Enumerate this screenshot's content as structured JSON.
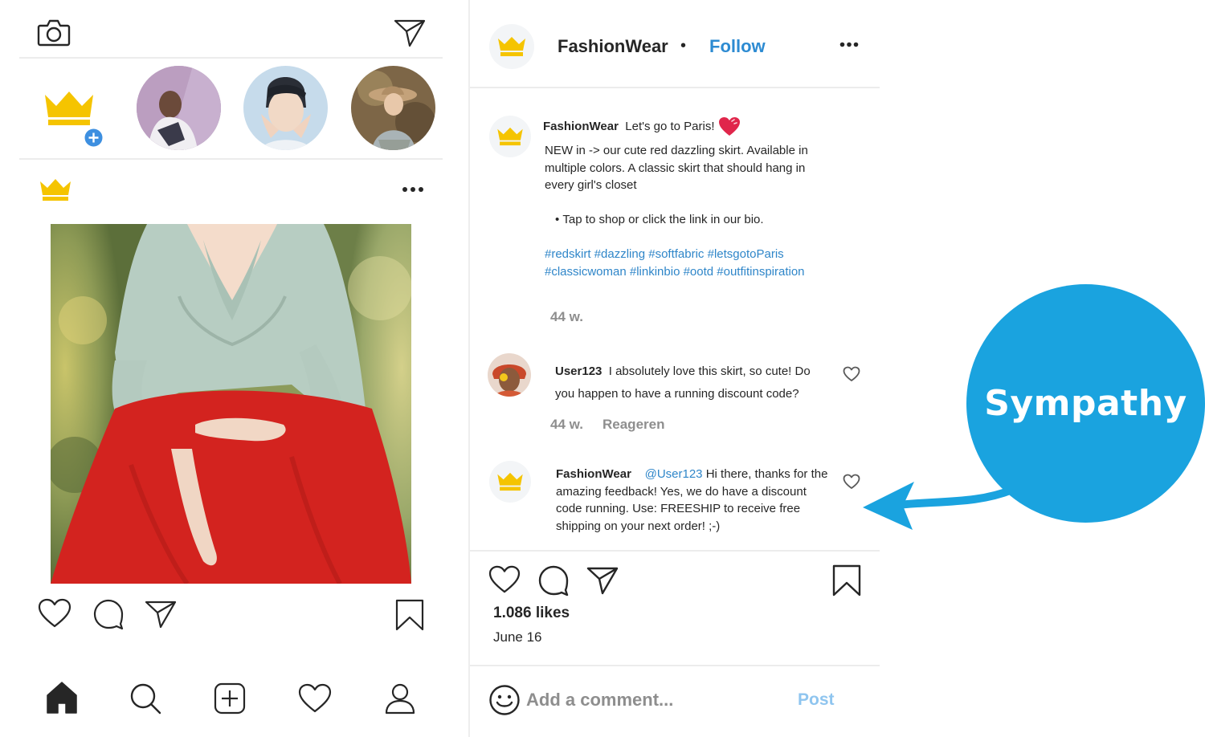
{
  "left_feed": {
    "icons": [
      "camera-icon",
      "direct-message-icon",
      "crown-icon",
      "add-story-icon",
      "more-icon",
      "heart-icon",
      "comment-icon",
      "share-icon",
      "bookmark-icon"
    ],
    "stories": [
      {
        "name": "story-own",
        "icon": "crown-icon"
      },
      {
        "name": "story-user-1",
        "colors": [
          "#c9b3c9",
          "#7a6b86"
        ]
      },
      {
        "name": "story-user-2",
        "colors": [
          "#bcd3e8",
          "#e8d6c9"
        ]
      },
      {
        "name": "story-user-3",
        "colors": [
          "#8a7052",
          "#d7c3a3"
        ]
      }
    ],
    "post_photo_description_colors": {
      "blouse": "#b8cfc5",
      "skirt": "#d3231f",
      "background": "#8fa26a"
    }
  },
  "bottom_nav": {
    "items": [
      "home-icon",
      "search-icon",
      "new-post-icon",
      "activity-icon",
      "profile-icon"
    ]
  },
  "post_detail": {
    "header": {
      "account_name": "FashionWear",
      "separator": "•",
      "follow_label": "Follow"
    },
    "caption": {
      "author": "FashionWear",
      "first_line": "Let's go to Paris!",
      "body": "NEW in -> our cute red dazzling skirt. Available in multiple colors. A classic skirt that should hang in every girl's closet",
      "bullet": "Tap to shop or click the link in our bio.",
      "hashtags": "#redskirt #dazzling #softfabric #letsgotoParis #classicwoman #linkinbio #ootd #outfitinspiration",
      "age": "44 w."
    },
    "comments": [
      {
        "author": "User123",
        "text": "I absolutely love this skirt, so cute! Do you happen to have a running discount code?",
        "age": "44 w.",
        "reply_label": "Reageren"
      },
      {
        "author": "FashionWear",
        "mention": "@User123",
        "text": "Hi there, thanks for the amazing feedback! Yes, we do have a discount code running. Use: FREESHIP to receive free shipping on your next order! ;-)"
      }
    ],
    "likes": "1.086 likes",
    "date": "June 16",
    "comment_input": {
      "placeholder": "Add a comment...",
      "post_label": "Post"
    }
  },
  "callout": {
    "label": "Sympathy"
  },
  "colors": {
    "crown": "#f5c400",
    "accent_blue": "#2f86c9",
    "follow_blue": "#2d8bd2",
    "callout_blue": "#1aa3df",
    "heart_red": "#e0264b",
    "icon_gray": "#262626",
    "post_button_blue": "#8fc5ef"
  }
}
